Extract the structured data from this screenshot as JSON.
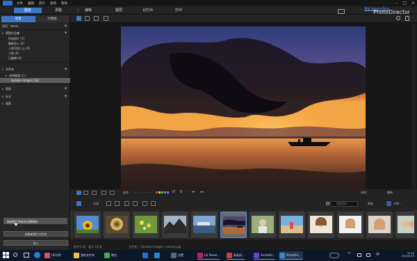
{
  "menubar": {
    "items": [
      "文件",
      "编辑",
      "照片",
      "查看",
      "帮助"
    ]
  },
  "mode_tabs": [
    {
      "label": "图库",
      "active": true
    },
    {
      "label": "调整",
      "active": false
    },
    {
      "label": "编辑",
      "active": false
    },
    {
      "label": "图层",
      "active": false
    },
    {
      "label": "幻灯片",
      "active": false
    },
    {
      "label": "打印",
      "active": false
    }
  ],
  "header": {
    "login_link": "登录 DirectorZone",
    "brand": "PhotoDirector"
  },
  "left_panel": {
    "tabs": [
      {
        "label": "项目",
        "active": true
      },
      {
        "label": "元数据",
        "active": false
      }
    ],
    "project_header": "项目：demo",
    "view_header": "视图作品集",
    "view_items": [
      "所有照片 (7)",
      "最新导入 (0)",
      "人脸识别人士 (0)",
      "人脸 (0)",
      "已编辑 (0)"
    ],
    "folders_header": "文件夹",
    "folder_items": [
      {
        "label": "本地磁盘 (C:)",
        "selected": false
      },
      {
        "label": "Sample Images (14)",
        "selected": true
      }
    ],
    "sections": [
      "相册",
      "标记",
      "搜索"
    ],
    "slider_label": "拖放照片到此处创建相册",
    "buttons": [
      "创建新图片文件夹",
      "导入"
    ]
  },
  "viewer_controls": {
    "zoom_label": "适合",
    "sort_label": "时间：",
    "sort_value": "最新",
    "rating_dots": "- - - - - -"
  },
  "filmstrip_toolbar": {
    "left_text": "过滤",
    "search_placeholder": "搜索照片",
    "right_text_1": "筛选",
    "right_text_2": "分享..."
  },
  "status": {
    "count": "选中 1 项 · 显示 14 项",
    "path": "文件夹：/ Sample Images / sunrise.jpg"
  },
  "taskbar": {
    "items": [
      "UP计划",
      "我的文件夹",
      "微信",
      "设置",
      "LG Power...",
      "高画质...",
      "AudioDir...",
      "PhotoDir..."
    ],
    "clock_time": "19:35",
    "clock_date": "2023/5/15"
  }
}
